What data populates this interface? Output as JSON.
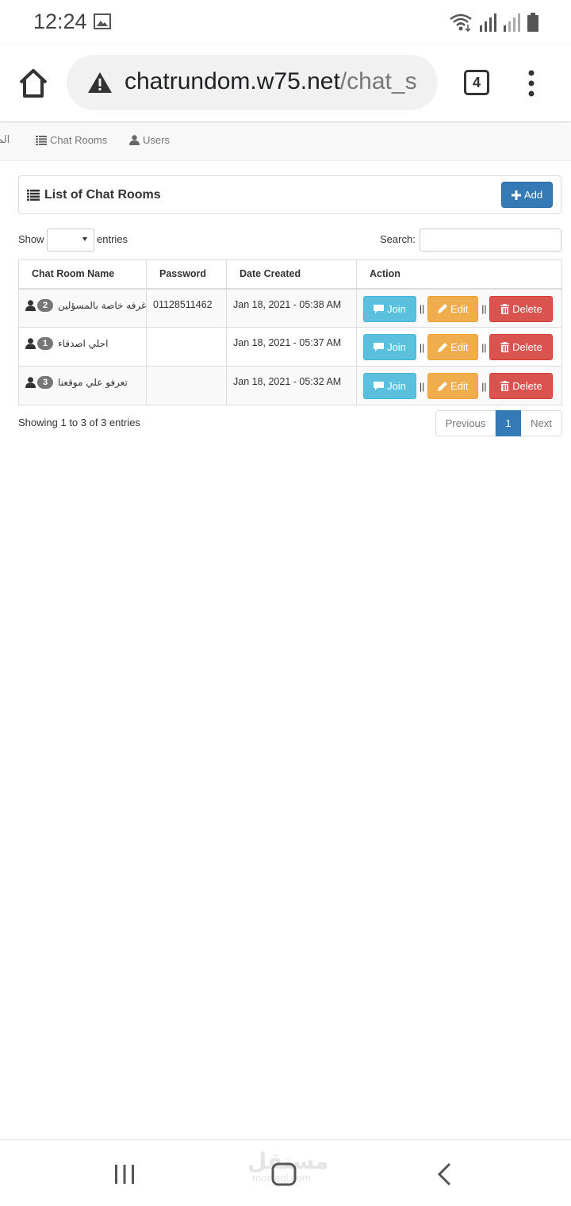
{
  "status_bar": {
    "time": "12:24"
  },
  "browser": {
    "url_main": "chatrundom.w75.net",
    "url_rest": "/chat_s",
    "tab_count": "4"
  },
  "nav": {
    "cut_item": "الم",
    "chat_rooms": "Chat Rooms",
    "users": "Users"
  },
  "panel": {
    "title": "List of Chat Rooms",
    "add_label": "Add"
  },
  "controls": {
    "show_label": "Show",
    "entries_label": "entries",
    "search_label": "Search:",
    "search_value": ""
  },
  "table": {
    "headers": [
      "Chat Room Name",
      "Password",
      "Date Created",
      "Action"
    ],
    "rows": [
      {
        "count": "2",
        "name": "غرفه خاصة بالمسؤلين",
        "password": "01128511462",
        "date": "Jan 18, 2021 - 05:38 AM"
      },
      {
        "count": "1",
        "name": "احلي اصدقاء",
        "password": "",
        "date": "Jan 18, 2021 - 05:37 AM"
      },
      {
        "count": "3",
        "name": "تعرفو علي موقعنا",
        "password": "",
        "date": "Jan 18, 2021 - 05:32 AM"
      }
    ],
    "actions": {
      "join": "Join",
      "edit": "Edit",
      "delete": "Delete",
      "separator": "||"
    }
  },
  "footer": {
    "info": "Showing 1 to 3 of 3 entries",
    "previous": "Previous",
    "current_page": "1",
    "next": "Next"
  },
  "watermark": {
    "main": "مستقل",
    "sub": "mostaql.com"
  },
  "colors": {
    "primary": "#337ab7",
    "info": "#5bc0de",
    "warning": "#f0ad4e",
    "danger": "#d9534f",
    "badge": "#777777"
  }
}
